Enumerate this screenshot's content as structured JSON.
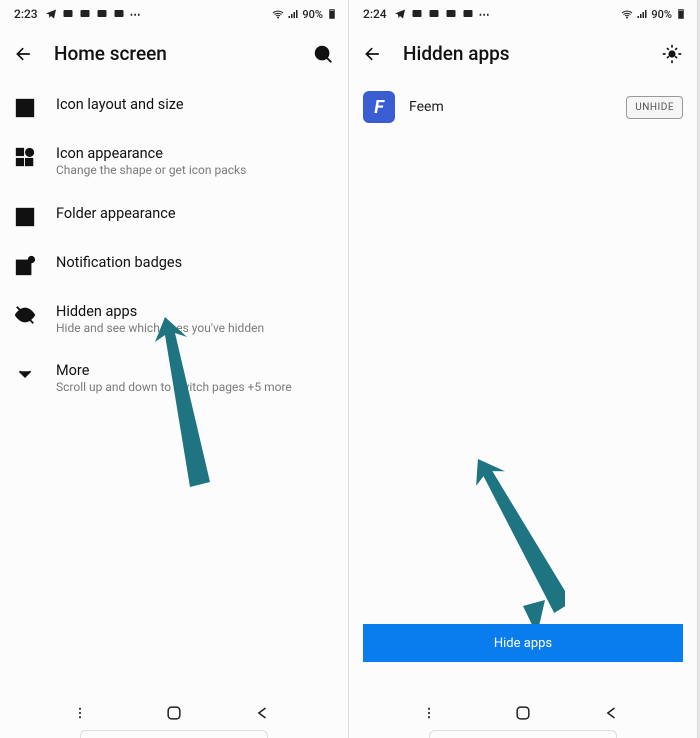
{
  "left": {
    "status": {
      "time": "2:23",
      "battery": "90%"
    },
    "header": {
      "title": "Home screen"
    },
    "rows": {
      "iconLayout": {
        "title": "Icon layout and size"
      },
      "iconAppearance": {
        "title": "Icon appearance",
        "sub": "Change the shape or get icon packs"
      },
      "folderAppearance": {
        "title": "Folder appearance"
      },
      "notificationBadges": {
        "title": "Notification badges"
      },
      "hiddenApps": {
        "title": "Hidden apps",
        "sub": "Hide and see which ones you've hidden"
      },
      "more": {
        "title": "More",
        "sub": "Scroll up and down to switch pages +5 more"
      }
    }
  },
  "right": {
    "status": {
      "time": "2:24",
      "battery": "90%"
    },
    "header": {
      "title": "Hidden apps"
    },
    "app": {
      "name": "Feem",
      "unhide": "UNHIDE"
    },
    "hideBtn": "Hide apps"
  }
}
